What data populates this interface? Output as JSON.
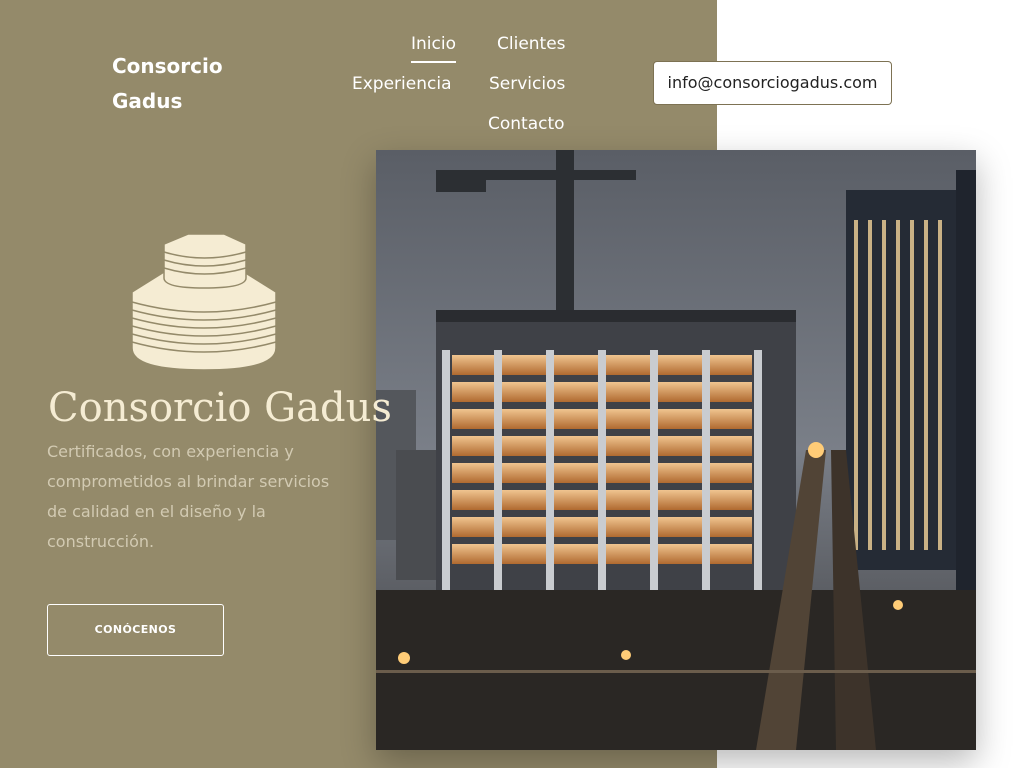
{
  "brand": {
    "name": "Consorcio Gadus"
  },
  "nav": {
    "inicio": "Inicio",
    "clientes": "Clientes",
    "experiencia": "Experiencia",
    "servicios": "Servicios",
    "contacto": "Contacto",
    "active": "Inicio"
  },
  "contact": {
    "email": "info@consorciogadus.com"
  },
  "hero": {
    "logo_text": "Consorcio Gadus",
    "tagline": "Certificados, con experiencia y comprometidos al brindar servicios de calidad en el diseño y la construcción.",
    "cta_label": "CONÓCENOS",
    "image_description_icon": "construction-building-photo"
  },
  "colors": {
    "panel": "#948a6a",
    "logo_cream": "#f5ecd3",
    "tagline": "#d2cab2",
    "background": "#ffffff"
  }
}
